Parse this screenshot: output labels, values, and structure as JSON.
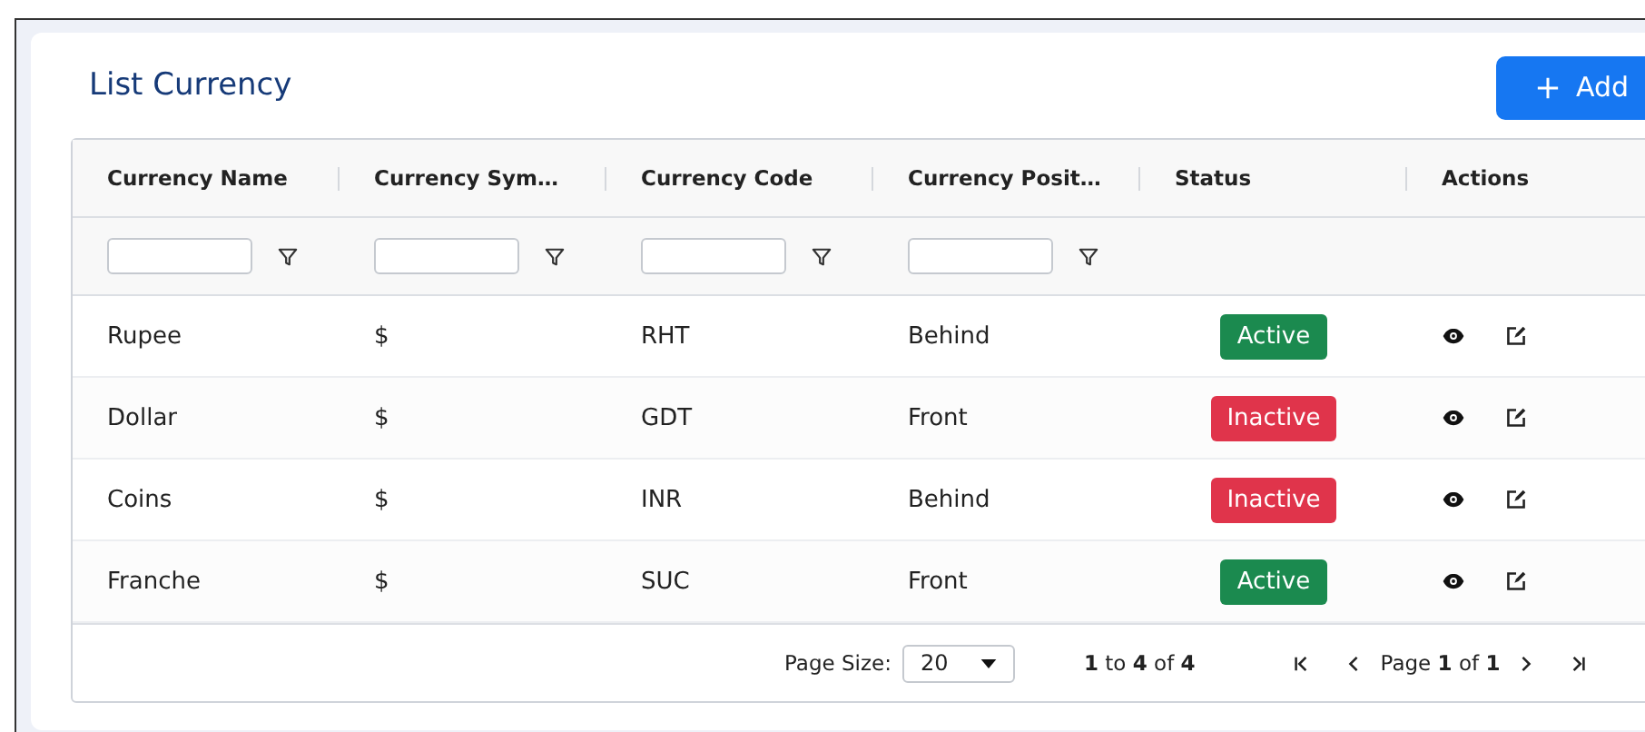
{
  "title": "List Currency",
  "add_button": {
    "label": "Add"
  },
  "table": {
    "columns": [
      {
        "label": "Currency Name",
        "filterable": true
      },
      {
        "label": "Currency Sym…",
        "filterable": true
      },
      {
        "label": "Currency Code",
        "filterable": true
      },
      {
        "label": "Currency Posit…",
        "filterable": true
      },
      {
        "label": "Status",
        "filterable": false
      },
      {
        "label": "Actions",
        "filterable": false
      }
    ],
    "rows": [
      {
        "name": "Rupee",
        "symbol": "$",
        "code": "RHT",
        "position": "Behind",
        "status": {
          "label": "Active",
          "kind": "active"
        }
      },
      {
        "name": "Dollar",
        "symbol": "$",
        "code": "GDT",
        "position": "Front",
        "status": {
          "label": "Inactive",
          "kind": "inactive"
        }
      },
      {
        "name": "Coins",
        "symbol": "$",
        "code": "INR",
        "position": "Behind",
        "status": {
          "label": "Inactive",
          "kind": "inactive"
        }
      },
      {
        "name": "Franche",
        "symbol": "$",
        "code": "SUC",
        "position": "Front",
        "status": {
          "label": "Active",
          "kind": "active"
        }
      }
    ]
  },
  "pager": {
    "page_size_label": "Page Size:",
    "page_size": "20",
    "range": "**1** to **4** of **4**",
    "page": "Page **1** of **1**"
  }
}
